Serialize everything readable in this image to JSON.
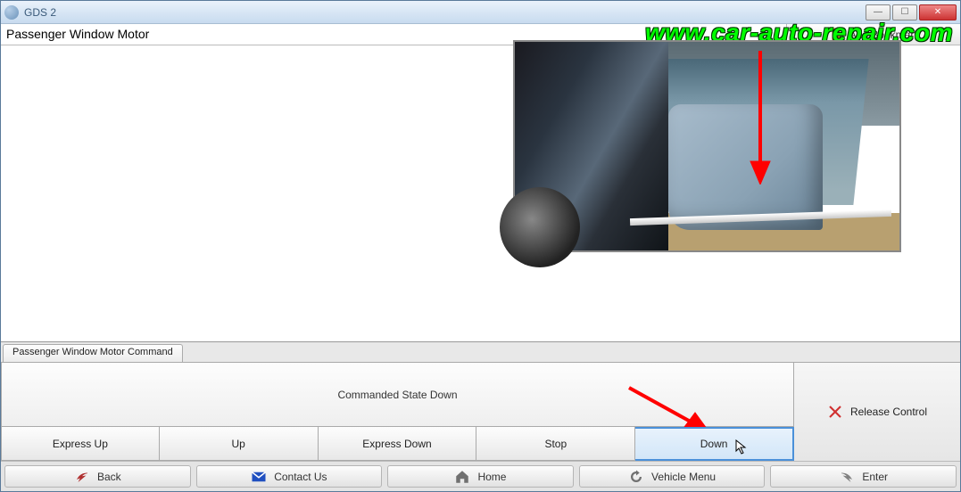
{
  "window": {
    "title": "GDS 2"
  },
  "watermark": "www.car-auto-repair.com",
  "header": {
    "page_title": "Passenger Window Motor",
    "bookmark_label": "Add Bookmark"
  },
  "command_panel": {
    "tab_label": "Passenger Window Motor Command",
    "status_text": "Commanded State Down",
    "release_label": "Release Control",
    "buttons": {
      "express_up": "Express Up",
      "up": "Up",
      "express_down": "Express Down",
      "stop": "Stop",
      "down": "Down"
    },
    "selected": "down"
  },
  "bottom_nav": {
    "back": "Back",
    "contact": "Contact Us",
    "home": "Home",
    "vehicle_menu": "Vehicle Menu",
    "enter": "Enter"
  }
}
